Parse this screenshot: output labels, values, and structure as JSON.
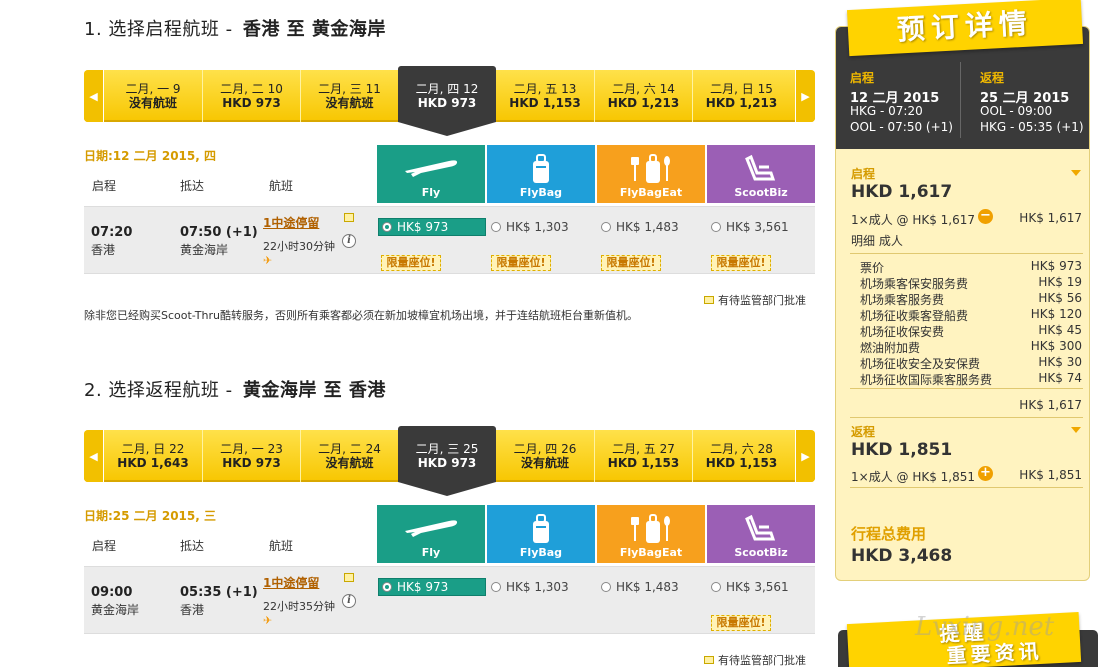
{
  "outbound": {
    "title_num": "1.",
    "title_text": "选择启程航班 -",
    "route": "香港  至  黄金海岸",
    "dates": [
      {
        "d1": "二月, 一 9",
        "d2": "没有航班"
      },
      {
        "d1": "二月, 二 10",
        "d2": "HKD 973"
      },
      {
        "d1": "二月, 三 11",
        "d2": "没有航班"
      },
      {
        "d1": "二月, 四 12",
        "d2": "HKD 973"
      },
      {
        "d1": "二月, 五 13",
        "d2": "HKD 1,153"
      },
      {
        "d1": "二月, 六 14",
        "d2": "HKD 1,213"
      },
      {
        "d1": "二月, 日 15",
        "d2": "HKD 1,213"
      }
    ],
    "date_label": "日期:12 二月 2015, 四",
    "col_depart": "启程",
    "col_arrive": "抵达",
    "col_flight": "航班",
    "flight": {
      "dep_time": "07:20",
      "dep_city": "香港",
      "arr_time": "07:50 (+1)",
      "arr_city": "黄金海岸",
      "stops": "1中途停留",
      "duration": "22小时30分钟",
      "fares": [
        "HK$ 973",
        "HK$ 1,303",
        "HK$ 1,483",
        "HK$ 3,561"
      ],
      "limited": "限量座位!"
    },
    "pending": "有待监管部门批准"
  },
  "notice": "除非您已经购买Scoot-Thru酷转服务，否则所有乘客都必须在新加坡樟宜机场出境，并于连结航班柜台重新值机。",
  "inbound": {
    "title_num": "2.",
    "title_text": "选择返程航班 -",
    "route": "黄金海岸  至  香港",
    "dates": [
      {
        "d1": "二月, 日 22",
        "d2": "HKD 1,643"
      },
      {
        "d1": "二月, 一 23",
        "d2": "HKD 973"
      },
      {
        "d1": "二月, 二 24",
        "d2": "没有航班"
      },
      {
        "d1": "二月, 三 25",
        "d2": "HKD 973"
      },
      {
        "d1": "二月, 四 26",
        "d2": "没有航班"
      },
      {
        "d1": "二月, 五 27",
        "d2": "HKD 1,153"
      },
      {
        "d1": "二月, 六 28",
        "d2": "HKD 1,153"
      }
    ],
    "date_label": "日期:25 二月 2015, 三",
    "col_depart": "启程",
    "col_arrive": "抵达",
    "col_flight": "航班",
    "flight": {
      "dep_time": "09:00",
      "dep_city": "黄金海岸",
      "arr_time": "05:35 (+1)",
      "arr_city": "香港",
      "stops": "1中途停留",
      "duration": "22小时35分钟",
      "fares": [
        "HK$ 973",
        "HK$ 1,303",
        "HK$ 1,483",
        "HK$ 3,561"
      ],
      "limited": "限量座位!"
    },
    "pending": "有待监管部门批准"
  },
  "fare_types": [
    "Fly",
    "FlyBag",
    "FlyBagEat",
    "ScootBiz"
  ],
  "sidebar": {
    "title": "预订详情",
    "out_head": "启程",
    "out_date": "12 二月 2015",
    "out_dep": "HKG - 07:20",
    "out_arr": "OOL - 07:50 (+1)",
    "ret_head": "返程",
    "ret_date": "25 二月 2015",
    "ret_dep": "OOL - 09:00",
    "ret_arr": "HKG - 05:35 (+1)",
    "out_label": "启程",
    "out_amount": "HKD 1,617",
    "out_pax": "1×成人 @ HK$ 1,617",
    "out_pax_total": "HK$ 1,617",
    "detail": "明细 成人",
    "fees": [
      {
        "name": "票价",
        "val": "HK$ 973"
      },
      {
        "name": "机场乘客保安服务费",
        "val": "HK$ 19"
      },
      {
        "name": "机场乘客服务费",
        "val": "HK$ 56"
      },
      {
        "name": "机场征收乘客登船费",
        "val": "HK$ 120"
      },
      {
        "name": "机场征收保安费",
        "val": "HK$ 45"
      },
      {
        "name": "燃油附加费",
        "val": "HK$ 300"
      },
      {
        "name": "机场征收安全及安保费",
        "val": "HK$ 30"
      },
      {
        "name": "机场征收国际乘客服务费",
        "val": "HK$ 74"
      }
    ],
    "fee_total": "HK$ 1,617",
    "ret_label": "返程",
    "ret_amount": "HKD 1,851",
    "ret_pax": "1×成人 @ HK$ 1,851",
    "ret_pax_total": "HK$ 1,851",
    "total_label": "行程总费用",
    "total_amount": "HKD 3,468",
    "reminder_title": "提醒",
    "reminder_sub": "重要资讯"
  },
  "watermark": "Lvxing.net",
  "colors": {
    "accent": "#ffd300",
    "fly": "#1a9e87",
    "flybag": "#1f9fd9",
    "flybageat": "#f7a01d",
    "scootbiz": "#9b5fb5"
  }
}
